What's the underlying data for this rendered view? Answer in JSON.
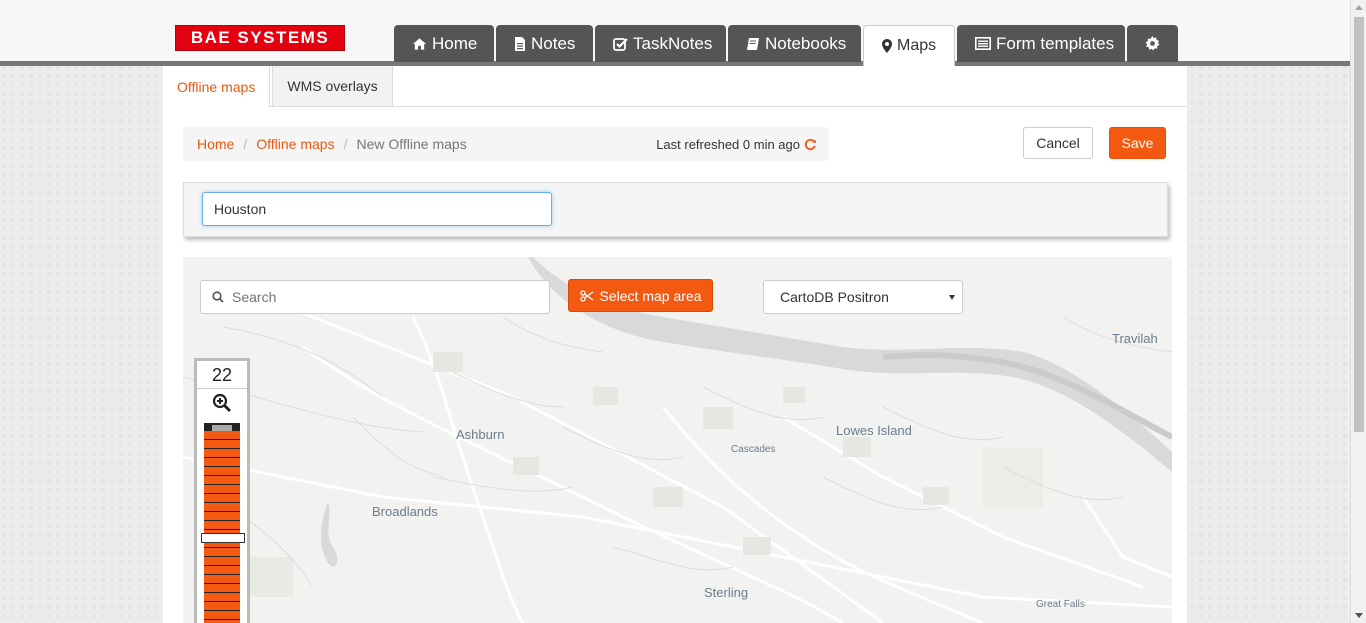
{
  "header": {
    "logo_text": "BAE SYSTEMS",
    "tabs": [
      {
        "label": "Home",
        "icon": "home-icon"
      },
      {
        "label": "Notes",
        "icon": "file-text-icon"
      },
      {
        "label": "TaskNotes",
        "icon": "check-square-icon"
      },
      {
        "label": "Notebooks",
        "icon": "book-icon"
      },
      {
        "label": "Maps",
        "icon": "map-marker-icon",
        "active": true
      },
      {
        "label": "Form templates",
        "icon": "list-alt-icon"
      },
      {
        "label": "",
        "icon": "gear-icon"
      }
    ]
  },
  "subtabs": {
    "offline_maps": "Offline maps",
    "wms_overlays": "WMS overlays"
  },
  "breadcrumb": {
    "home": "Home",
    "offline_maps": "Offline maps",
    "current": "New Offline maps",
    "separator": "/"
  },
  "status": {
    "last_refreshed": "Last refreshed 0 min ago"
  },
  "actions": {
    "cancel": "Cancel",
    "save": "Save"
  },
  "form": {
    "name_value": "Houston"
  },
  "map": {
    "search_placeholder": "Search",
    "select_area_label": "Select map area",
    "layer_selected": "CartoDB Positron",
    "zoom_level": "22",
    "zoom_slider_fraction": 0.55,
    "places": {
      "travilah": "Travilah",
      "ashburn": "Ashburn",
      "lowes_island": "Lowes Island",
      "cascades": "Cascades",
      "broadlands": "Broadlands",
      "sterling": "Sterling",
      "great_falls": "Great Falls"
    }
  },
  "colors": {
    "accent": "#f35910",
    "logo_red": "#e3000f",
    "tab_dark": "#555555"
  }
}
